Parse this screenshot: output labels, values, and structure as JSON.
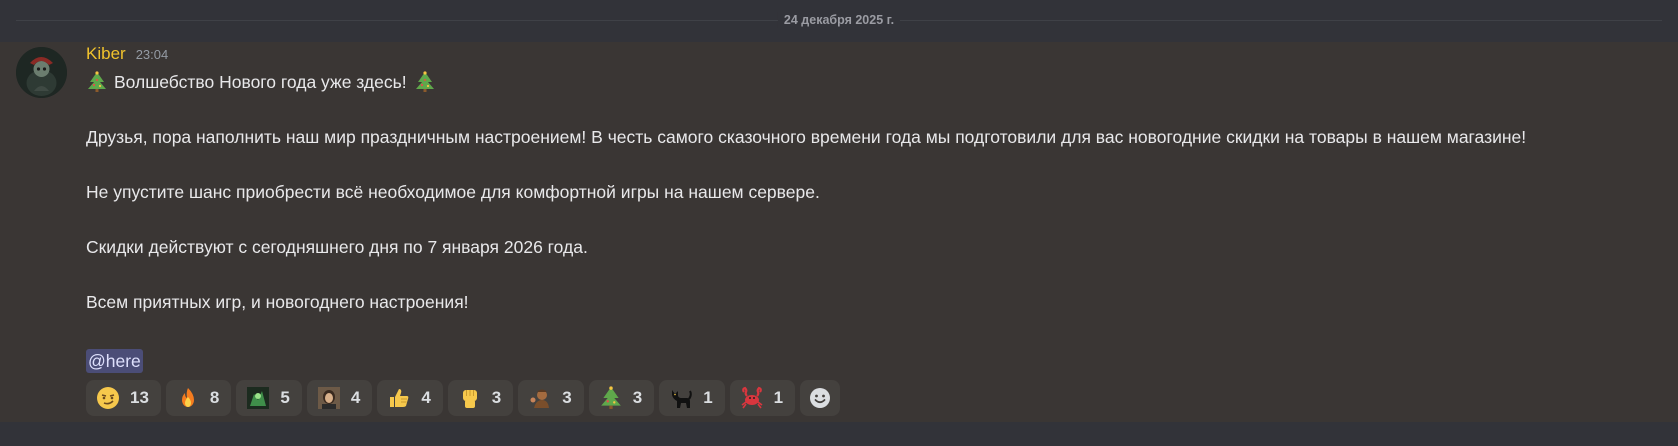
{
  "date_divider": "24 декабря 2025 г.",
  "message": {
    "author": "Kiber",
    "timestamp": "23:04",
    "title_text": "Волшебство Нового года уже здесь!",
    "lines": [
      "Друзья, пора наполнить наш мир праздничным настроением! В честь самого сказочного времени года мы подготовили для вас новогодние скидки на товары в нашем магазине!",
      "Не упустите шанс приобрести всё необходимое для комфортной игры на нашем сервере.",
      "Скидки действуют с сегодняшнего дня по 7 января 2026 года.",
      "Всем приятных игр, и новогоднего настроения!"
    ],
    "mention": "@here"
  },
  "reactions": [
    {
      "icon": "smirk-face-icon",
      "count": "13"
    },
    {
      "icon": "fire-icon",
      "count": "8"
    },
    {
      "icon": "custom-green-emoji-icon",
      "count": "5"
    },
    {
      "icon": "custom-portrait-emoji-icon",
      "count": "4"
    },
    {
      "icon": "thumbs-up-icon",
      "count": "4"
    },
    {
      "icon": "raised-fist-icon",
      "count": "3"
    },
    {
      "icon": "custom-character-emoji-icon",
      "count": "3"
    },
    {
      "icon": "christmas-tree-icon",
      "count": "3"
    },
    {
      "icon": "black-cat-icon",
      "count": "1"
    },
    {
      "icon": "crab-icon",
      "count": "1"
    }
  ],
  "add_reaction_icon": "add-reaction-smiley-icon"
}
